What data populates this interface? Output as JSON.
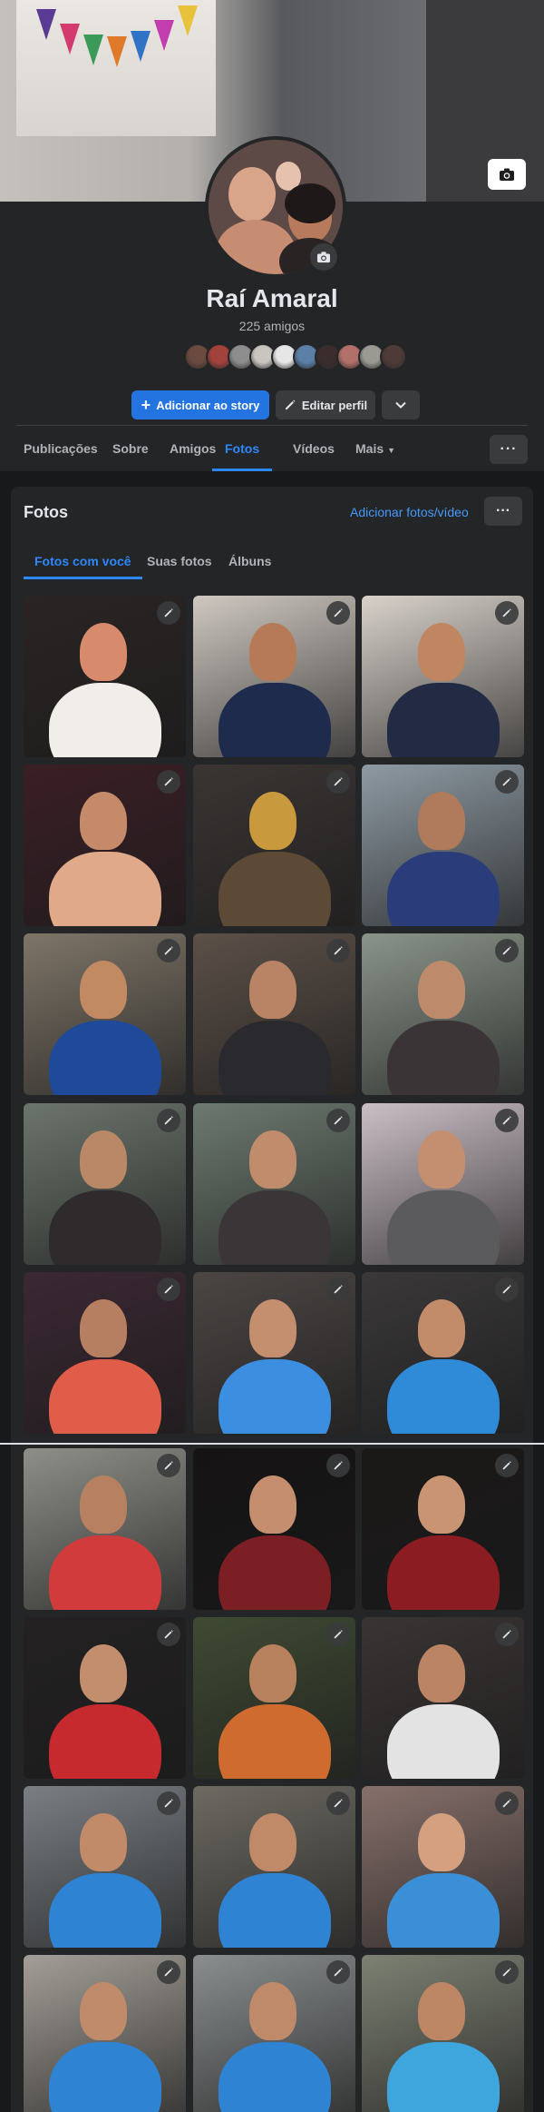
{
  "profile": {
    "name": "Raí Amaral",
    "friends_count": "225 amigos",
    "cover_image": "birthday party cover photo",
    "avatar_image": "profile photo",
    "friend_face_colors": [
      "#6b4a3f",
      "#a3413d",
      "#8d8d8d",
      "#c9c6c0",
      "#e6e6e6",
      "#5b7fa6",
      "#3a2d2c",
      "#b2706a",
      "#9a9a92",
      "#4e3a36"
    ]
  },
  "actions": {
    "add_story": "Adicionar ao story",
    "edit_profile": "Editar perfil"
  },
  "nav": {
    "tabs": [
      "Publicações",
      "Sobre",
      "Amigos",
      "Fotos",
      "Vídeos",
      "Mais"
    ],
    "active_tab": "Fotos"
  },
  "photos": {
    "title": "Fotos",
    "add_photos": "Adicionar fotos/vídeo",
    "tabs": [
      "Fotos com você",
      "Suas fotos",
      "Álbuns"
    ],
    "active_tab": "Fotos com você",
    "items": [
      {
        "bg": "#2a2524",
        "a": "#d88b6c",
        "b": "#f1eee9"
      },
      {
        "bg": "#cfc8c1",
        "a": "#b67a58",
        "b": "#1f2b4d"
      },
      {
        "bg": "#d9d2cb",
        "a": "#c08561",
        "b": "#222b43"
      },
      {
        "bg": "#3a1f26",
        "a": "#c58a6a",
        "b": "#e0a98a"
      },
      {
        "bg": "#3a3533",
        "a": "#c89a3d",
        "b": "#5c4a36"
      },
      {
        "bg": "#8e9aa3",
        "a": "#b07b5c",
        "b": "#2a3d7a"
      },
      {
        "bg": "#7e7568",
        "a": "#c18a62",
        "b": "#1f4a9a"
      },
      {
        "bg": "#5c5048",
        "a": "#b98466",
        "b": "#2a2a2e"
      },
      {
        "bg": "#8a948a",
        "a": "#be8a6c",
        "b": "#3b3436"
      },
      {
        "bg": "#6c756c",
        "a": "#b98867",
        "b": "#2f2b2c"
      },
      {
        "bg": "#6d7a70",
        "a": "#c18c6c",
        "b": "#3a3537"
      },
      {
        "bg": "#cbbfc6",
        "a": "#c38f70",
        "b": "#5b5b5e"
      },
      {
        "bg": "#3b2833",
        "a": "#b77f62",
        "b": "#e05d4a"
      },
      {
        "bg": "#4b4644",
        "a": "#c48f6e",
        "b": "#3b8ee0"
      },
      {
        "bg": "#3a3839",
        "a": "#c28b6a",
        "b": "#2f8ad8"
      },
      {
        "bg": "#8f8f89",
        "a": "#b78161",
        "b": "#d23b3b"
      },
      {
        "bg": "#151313",
        "a": "#c58f6f",
        "b": "#7c1f25"
      },
      {
        "bg": "#1b1818",
        "a": "#c99474",
        "b": "#8a1c22"
      },
      {
        "bg": "#232121",
        "a": "#c38e6e",
        "b": "#c72a2e"
      },
      {
        "bg": "#3f4a33",
        "a": "#b9825f",
        "b": "#d06b2f"
      },
      {
        "bg": "#3a3434",
        "a": "#bb8565",
        "b": "#e3e3e3"
      },
      {
        "bg": "#7a7f84",
        "a": "#c18a69",
        "b": "#2f83d3"
      },
      {
        "bg": "#6d6a62",
        "a": "#c08a68",
        "b": "#2f83d3"
      },
      {
        "bg": "#87706b",
        "a": "#d4a07f",
        "b": "#3a8fd6"
      },
      {
        "bg": "#a39e97",
        "a": "#c08b6a",
        "b": "#2f83d3"
      },
      {
        "bg": "#8a8e8f",
        "a": "#bf8a69",
        "b": "#2f83d3"
      },
      {
        "bg": "#7d8173",
        "a": "#bd8766",
        "b": "#3ea6dc"
      }
    ]
  }
}
